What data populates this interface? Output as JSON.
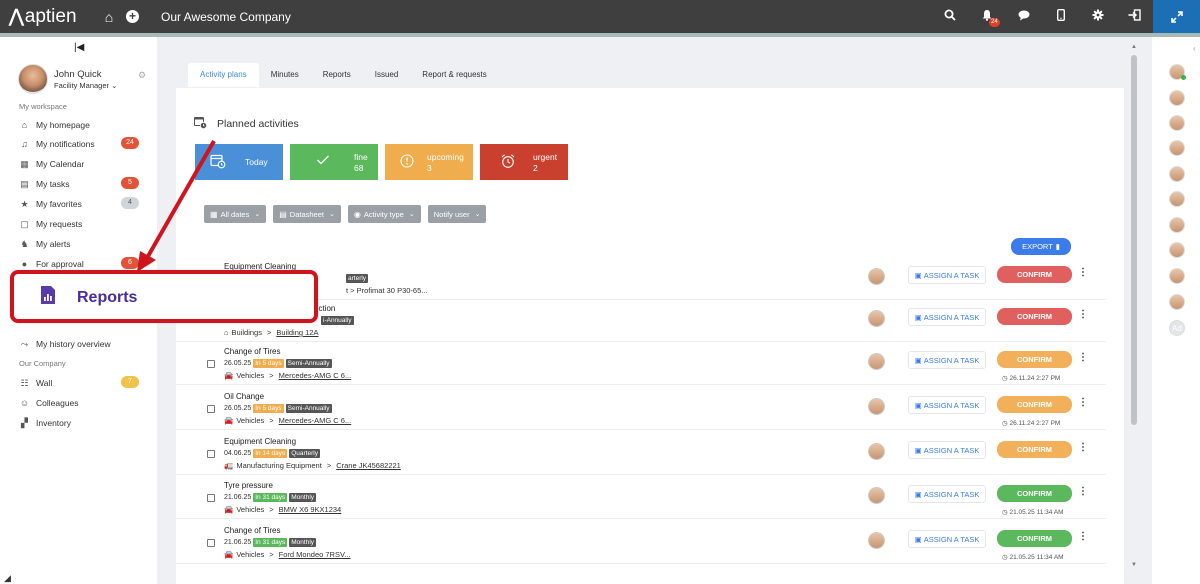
{
  "topbar": {
    "logo_text": "aptien",
    "company": "Our Awesome Company",
    "notification_count": "24"
  },
  "profile": {
    "name": "John Quick",
    "role": "Facility Manager"
  },
  "sections": {
    "workspace": "My workspace",
    "company": "Our Company"
  },
  "nav": {
    "homepage": "My homepage",
    "notifications": "My notifications",
    "notifications_count": "24",
    "calendar": "My Calendar",
    "tasks": "My tasks",
    "tasks_count": "5",
    "favorites": "My favorites",
    "favorites_count": "4",
    "requests": "My requests",
    "alerts": "My alerts",
    "approval": "For approval",
    "approval_count": "6",
    "history": "My history overview",
    "wall": "Wall",
    "wall_count": "7",
    "colleagues": "Colleagues",
    "inventory": "Inventory"
  },
  "callout": {
    "label": "Reports"
  },
  "tabs": {
    "t1": "Activity plans",
    "t2": "Minutes",
    "t3": "Reports",
    "t4": "Issued",
    "t5": "Report & requests"
  },
  "page_title": "Planned activities",
  "tiles": {
    "today": "Today",
    "fine_label": "fine",
    "fine_count": "68",
    "upcoming_label": "upcoming",
    "upcoming_count": "3",
    "urgent_label": "urgent",
    "urgent_count": "2"
  },
  "filters": {
    "dates": "All dates",
    "datasheet": "Datasheet",
    "type": "Activity type",
    "notify": "Notify user"
  },
  "export_label": "EXPORT",
  "assign_label": "ASSIGN A TASK",
  "confirm_label": "CONFIRM",
  "rows": [
    {
      "title": "Equipment Cleaning",
      "date": "",
      "due": "",
      "freq": "arterly",
      "crumb_a": "",
      "crumb_b": "t  >  Profimat 30 P30-65...",
      "ts": ""
    },
    {
      "title": "ection",
      "date": "",
      "due": "",
      "freq": "i-Annually",
      "crumb_a": "Buildings",
      "crumb_b": "Building 12A",
      "ts": ""
    },
    {
      "title": "Change of Tires",
      "date": "26.05.25",
      "due": "In 5 days",
      "freq": "Semi-Annually",
      "crumb_a": "Vehicles",
      "crumb_b": "Mercedes-AMG C 6...",
      "ts": "26.11.24 2:27 PM"
    },
    {
      "title": "Oil Change",
      "date": "26.05.25",
      "due": "In 5 days",
      "freq": "Semi-Annually",
      "crumb_a": "Vehicles",
      "crumb_b": "Mercedes-AMG C 6...",
      "ts": "26.11.24 2:27 PM"
    },
    {
      "title": "Equipment Cleaning",
      "date": "04.06.25",
      "due": "In 14 days",
      "freq": "Quarterly",
      "crumb_a": "Manufacturing Equipment",
      "crumb_b": "Crane JK45682221",
      "ts": ""
    },
    {
      "title": "Tyre pressure",
      "date": "21.06.25",
      "due": "In 31 days",
      "freq": "Monthly",
      "crumb_a": "Vehicles",
      "crumb_b": "BMW X6 9KX1234",
      "ts": "21.05.25 11:34 AM"
    },
    {
      "title": "Change of Tires",
      "date": "21.06.25",
      "due": "In 31 days",
      "freq": "Monthly",
      "crumb_a": "Vehicles",
      "crumb_b": "Ford Mondeo 7RSV...",
      "ts": "21.05.25 11:34 AM"
    }
  ],
  "right_panel": {
    "ad_initials": "Ad"
  },
  "colors": {
    "topbar": "#3f3f3f",
    "accent_blue": "#3b7bea",
    "confirm_red": "#e06060",
    "confirm_orange": "#f2b05a",
    "confirm_green": "#5cb85c",
    "callout_border": "#d0141d"
  }
}
